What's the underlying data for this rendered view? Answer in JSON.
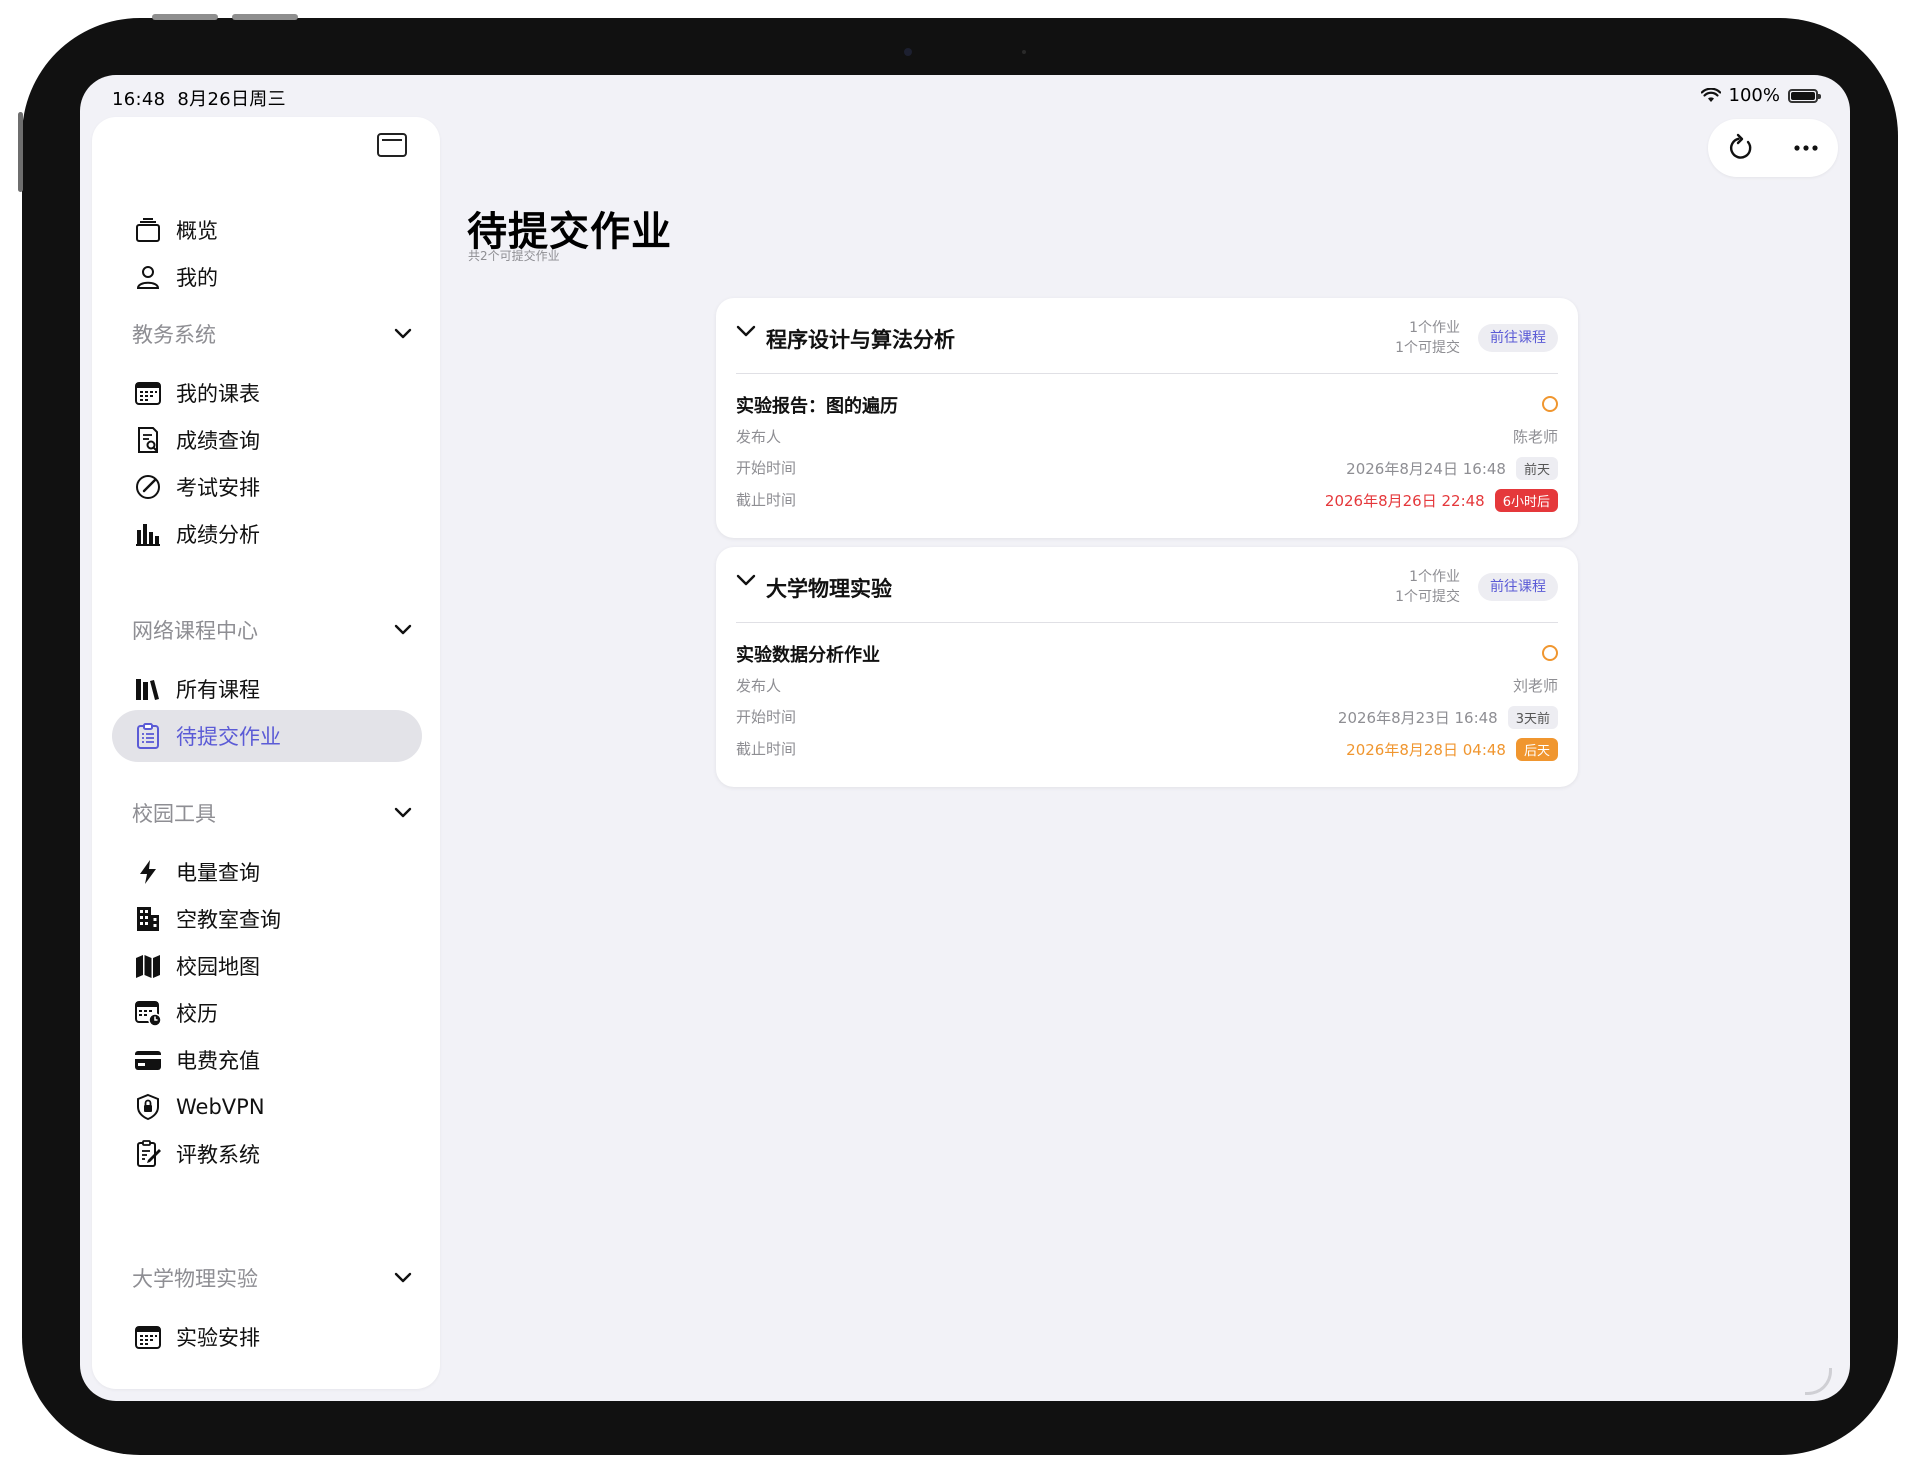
{
  "status_bar": {
    "time": "16:48",
    "date": "8月26日周三",
    "battery": "100%"
  },
  "sidebar": {
    "top_items": [
      {
        "label": "概览",
        "icon": "overview-icon"
      },
      {
        "label": "我的",
        "icon": "person-icon"
      }
    ],
    "sections": [
      {
        "title": "教务系统",
        "items": [
          {
            "label": "我的课表",
            "icon": "calendar-icon"
          },
          {
            "label": "成绩查询",
            "icon": "doc-search-icon"
          },
          {
            "label": "考试安排",
            "icon": "gauge-icon"
          },
          {
            "label": "成绩分析",
            "icon": "bar-chart-icon"
          }
        ]
      },
      {
        "title": "网络课程中心",
        "items": [
          {
            "label": "所有课程",
            "icon": "books-icon"
          },
          {
            "label": "待提交作业",
            "icon": "clipboard-icon",
            "active": true
          }
        ]
      },
      {
        "title": "校园工具",
        "items": [
          {
            "label": "电量查询",
            "icon": "bolt-icon"
          },
          {
            "label": "空教室查询",
            "icon": "building-icon"
          },
          {
            "label": "校园地图",
            "icon": "map-icon"
          },
          {
            "label": "校历",
            "icon": "calendar-clock-icon"
          },
          {
            "label": "电费充值",
            "icon": "card-icon"
          },
          {
            "label": "WebVPN",
            "icon": "shield-lock-icon"
          },
          {
            "label": "评教系统",
            "icon": "doc-edit-icon"
          }
        ]
      },
      {
        "title": "大学物理实验",
        "items": [
          {
            "label": "实验安排",
            "icon": "calendar-icon"
          }
        ]
      }
    ]
  },
  "main": {
    "title": "待提交作业",
    "subtitle": "共2个可提交作业",
    "courses": [
      {
        "name": "程序设计与算法分析",
        "meta_count": "1个作业",
        "meta_submit": "1个可提交",
        "goto_label": "前往课程",
        "task": {
          "name": "实验报告：图的遍历",
          "publisher_label": "发布人",
          "publisher": "陈老师",
          "start_label": "开始时间",
          "start": "2026年8月24日 16:48",
          "start_tag": "前天",
          "due_label": "截止时间",
          "due": "2026年8月26日 22:48",
          "due_tag": "6小时后"
        }
      },
      {
        "name": "大学物理实验",
        "meta_count": "1个作业",
        "meta_submit": "1个可提交",
        "goto_label": "前往课程",
        "task": {
          "name": "实验数据分析作业",
          "publisher_label": "发布人",
          "publisher": "刘老师",
          "start_label": "开始时间",
          "start": "2026年8月23日 16:48",
          "start_tag": "3天前",
          "due_label": "截止时间",
          "due": "2026年8月28日 04:48",
          "due_tag": "后天"
        }
      }
    ]
  },
  "colors": {
    "accent": "#5b5bd6",
    "urgent": "#e5383b",
    "warning": "#f0962f"
  }
}
